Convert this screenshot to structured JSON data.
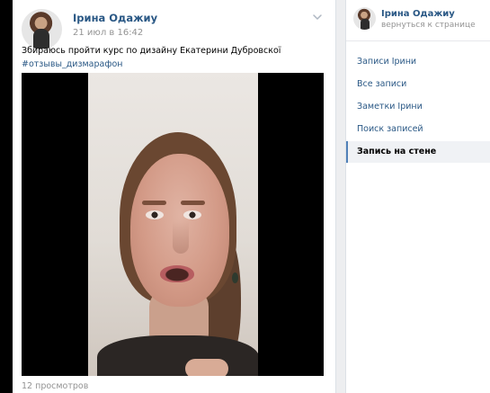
{
  "post": {
    "author": "Ірина Одажиу",
    "date": "21 июл в 16:42",
    "text": "Збираюсь пройти курс по дизайну Екатерини Дубровскої",
    "hashtag": "#отзывы_дизмарафон",
    "views": "12 просмотров"
  },
  "sidebar": {
    "profile_name": "Ірина Одажиу",
    "back_link": "вернуться к странице",
    "items": [
      {
        "label": "Записи Ірини"
      },
      {
        "label": "Все записи"
      },
      {
        "label": "Заметки Ірини"
      },
      {
        "label": "Поиск записей"
      },
      {
        "label": "Запись на стене"
      }
    ]
  },
  "icons": {
    "menu": "chevron-down-icon"
  },
  "colors": {
    "link": "#2a5885",
    "muted": "#939393",
    "active_bar": "#5181b8",
    "background": "#edeef0"
  }
}
